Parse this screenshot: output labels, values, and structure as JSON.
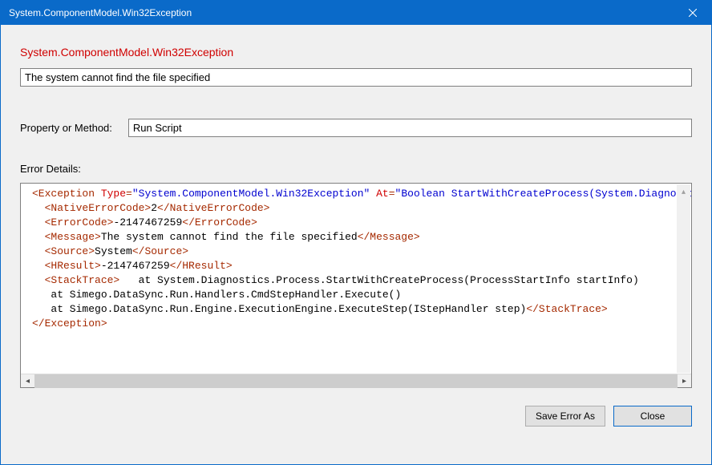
{
  "window": {
    "title": "System.ComponentModel.Win32Exception"
  },
  "heading": "System.ComponentModel.Win32Exception",
  "error_message": "The system cannot find the file specified",
  "property_label": "Property or Method:",
  "property_value": "Run Script",
  "details_label": "Error Details:",
  "exception": {
    "type": "System.ComponentModel.Win32Exception",
    "at": "Boolean StartWithCreateProcess(System.Diagnostics.Pro",
    "NativeErrorCode": "2",
    "ErrorCode": "-2147467259",
    "Message": "The system cannot find the file specified",
    "Source": "System",
    "HResult": "-2147467259",
    "StackTrace": "   at System.Diagnostics.Process.StartWithCreateProcess(ProcessStartInfo startInfo)\n   at Simego.DataSync.Run.Handlers.CmdStepHandler.Execute()\n   at Simego.DataSync.Run.Engine.ExecutionEngine.ExecuteStep(IStepHandler step)"
  },
  "buttons": {
    "save": "Save Error As",
    "close": "Close"
  }
}
